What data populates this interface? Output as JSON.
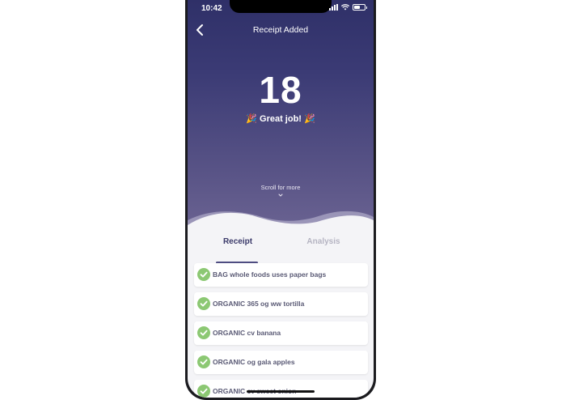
{
  "status_bar": {
    "time": "10:42"
  },
  "nav": {
    "title": "Receipt Added"
  },
  "hero": {
    "score": "18",
    "praise": "Great job!",
    "emoji": "🎉",
    "scroll_hint": "Scroll for more"
  },
  "tabs": [
    {
      "label": "Receipt",
      "active": true
    },
    {
      "label": "Analysis",
      "active": false
    }
  ],
  "receipt_items": [
    "BAG whole foods uses paper bags",
    "ORGANIC 365 og ww tortilla",
    "ORGANIC cv banana",
    "ORGANIC og gala apples",
    "ORGANIC cv sweet onion"
  ],
  "colors": {
    "hero_top": "#2f3068",
    "hero_bottom": "#6e6694",
    "check_green": "#8cc873",
    "accent": "#4f4d82"
  }
}
